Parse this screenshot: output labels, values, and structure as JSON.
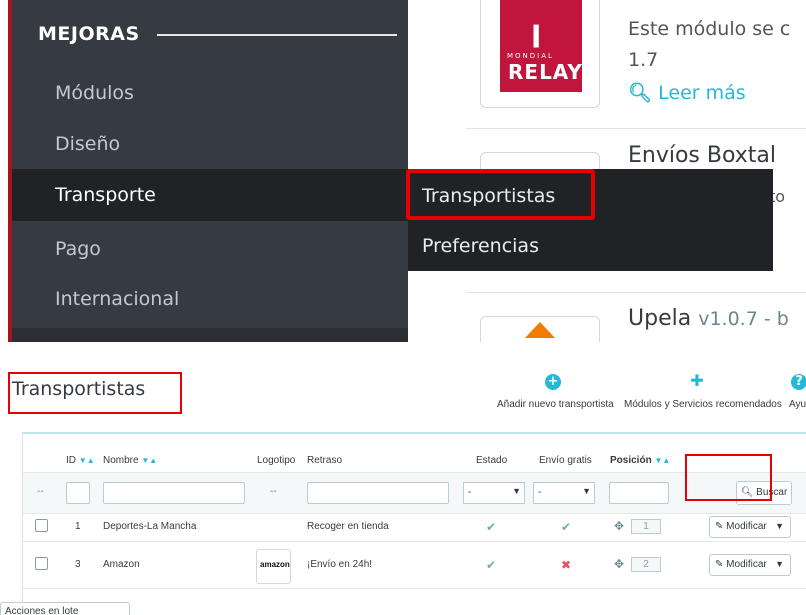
{
  "sidebar": {
    "section_title": "MEJORAS",
    "items": [
      {
        "label": "Módulos"
      },
      {
        "label": "Diseño"
      },
      {
        "label": "Transporte"
      },
      {
        "label": "Pago"
      },
      {
        "label": "Internacional"
      }
    ],
    "active_item": "Transporte",
    "flyout": {
      "items": [
        {
          "label": "Transportistas"
        },
        {
          "label": "Preferencias"
        }
      ]
    }
  },
  "modules": {
    "mod1": {
      "text": "Este módulo se c",
      "version": "1.7",
      "link": "Leer más",
      "logo_small": "MONDIAL",
      "logo_big": "RELAY"
    },
    "mod2": {
      "title": "Envíos Boxtal",
      "partial": "to"
    },
    "mod3": {
      "title": "Upela",
      "version": "v1.0.7 - b"
    }
  },
  "page": {
    "title": "Transportistas",
    "toolbar": {
      "add": "Añadir nuevo transportista",
      "modules": "Módulos y Servicios recomendados",
      "help": "Ayu"
    }
  },
  "table": {
    "headers": {
      "id": "ID",
      "name": "Nombre",
      "logo": "Logotipo",
      "delay": "Retraso",
      "status": "Estado",
      "free_shipping": "Envío gratis",
      "position": "Posición"
    },
    "filters": {
      "placeholder_dash": "--",
      "status_select": "-",
      "free_select": "-",
      "search_button": "Buscar"
    },
    "rows": [
      {
        "id": "1",
        "name": "Deportes-La Mancha",
        "logo": "",
        "delay": "Recoger en tienda",
        "status": "✔",
        "free": "✔",
        "position": "1",
        "action": "Modificar"
      },
      {
        "id": "3",
        "name": "Amazon",
        "logo": "amazon",
        "delay": "¡Envío en 24h!",
        "status": "✔",
        "free": "✖",
        "position": "2",
        "action": "Modificar"
      }
    ],
    "bulk_button": "Acciones en lote"
  },
  "icons": {
    "add": "plus-circle-icon",
    "modules": "puzzle-icon",
    "help": "question-circle-icon",
    "search": "search-icon",
    "edit": "pencil-icon",
    "drag": "move-icon"
  },
  "colors": {
    "sidebar_bg": "#363a41",
    "sidebar_active": "#202226",
    "accent": "#25b9d7",
    "highlight_red": "#e60000",
    "enabled_green": "#70b580",
    "disabled_red": "#e84e6a"
  }
}
